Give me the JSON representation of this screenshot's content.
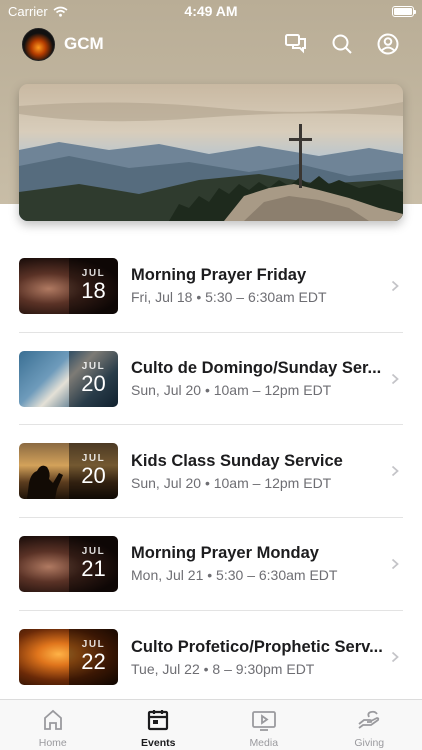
{
  "status_bar": {
    "carrier": "Carrier",
    "time": "4:49 AM"
  },
  "header": {
    "brand": "GCM"
  },
  "events": [
    {
      "month": "JUL",
      "day": "18",
      "title": "Morning Prayer Friday",
      "subtitle": "Fri, Jul 18 • 5:30 – 6:30am EDT",
      "thumb": "hands"
    },
    {
      "month": "JUL",
      "day": "20",
      "title": "Culto de Domingo/Sunday Ser...",
      "subtitle": "Sun, Jul 20 • 10am – 12pm EDT",
      "thumb": "bible"
    },
    {
      "month": "JUL",
      "day": "20",
      "title": "Kids Class Sunday Service",
      "subtitle": "Sun, Jul 20 • 10am – 12pm EDT",
      "thumb": "silhouette"
    },
    {
      "month": "JUL",
      "day": "21",
      "title": "Morning Prayer Monday",
      "subtitle": "Mon, Jul 21 • 5:30 – 6:30am EDT",
      "thumb": "hands"
    },
    {
      "month": "JUL",
      "day": "22",
      "title": "Culto Profetico/Prophetic Serv...",
      "subtitle": "Tue, Jul 22 • 8 – 9:30pm EDT",
      "thumb": "worship"
    }
  ],
  "tabs": [
    {
      "label": "Home",
      "icon": "home-icon",
      "active": false
    },
    {
      "label": "Events",
      "icon": "calendar-icon",
      "active": true
    },
    {
      "label": "Media",
      "icon": "media-icon",
      "active": false
    },
    {
      "label": "Giving",
      "icon": "giving-icon",
      "active": false
    }
  ],
  "colors": {
    "header_bg": "#b9ad96",
    "active_tab": "#1c1c1e",
    "inactive_tab": "#9a9a9e"
  }
}
